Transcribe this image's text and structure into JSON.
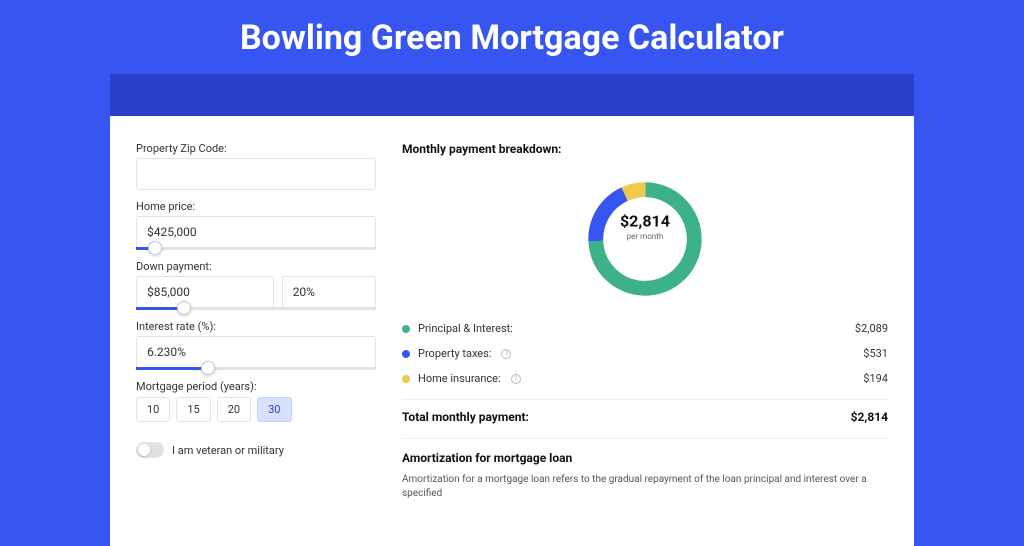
{
  "page_title": "Bowling Green Mortgage Calculator",
  "colors": {
    "principal": "#3db28a",
    "taxes": "#3755f0",
    "insurance": "#f0c94a"
  },
  "form": {
    "zip": {
      "label": "Property Zip Code:",
      "value": ""
    },
    "home_price": {
      "label": "Home price:",
      "value": "$425,000",
      "slider_fill_pct": 8
    },
    "down_payment": {
      "label": "Down payment:",
      "amount": "$85,000",
      "pct": "20%",
      "slider_fill_pct": 20
    },
    "interest": {
      "label": "Interest rate (%):",
      "value": "6.230%",
      "slider_fill_pct": 30
    },
    "period": {
      "label": "Mortgage period (years):",
      "options": [
        "10",
        "15",
        "20",
        "30"
      ],
      "selected": "30"
    },
    "veteran": {
      "label": "I am veteran or military",
      "checked": false
    }
  },
  "breakdown": {
    "title": "Monthly payment breakdown:",
    "total_amount": "$2,814",
    "total_sub": "per month",
    "items": [
      {
        "key": "principal",
        "label": "Principal & Interest:",
        "value": "$2,089",
        "info": false
      },
      {
        "key": "taxes",
        "label": "Property taxes:",
        "value": "$531",
        "info": true
      },
      {
        "key": "insurance",
        "label": "Home insurance:",
        "value": "$194",
        "info": true
      }
    ],
    "total_label": "Total monthly payment:"
  },
  "amortization": {
    "title": "Amortization for mortgage loan",
    "body": "Amortization for a mortgage loan refers to the gradual repayment of the loan principal and interest over a specified"
  },
  "chart_data": {
    "type": "pie",
    "title": "Monthly payment breakdown",
    "series": [
      {
        "name": "Principal & Interest",
        "value": 2089,
        "color": "#3db28a"
      },
      {
        "name": "Property taxes",
        "value": 531,
        "color": "#3755f0"
      },
      {
        "name": "Home insurance",
        "value": 194,
        "color": "#f0c94a"
      }
    ],
    "total": 2814,
    "center_label": "$2,814 per month"
  }
}
